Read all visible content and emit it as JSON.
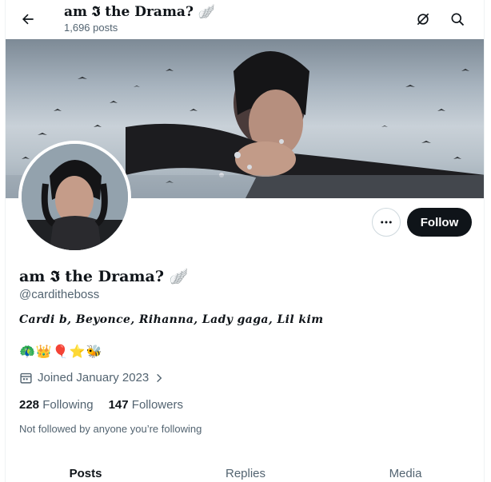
{
  "header": {
    "title": "am 𝕴 the Drama? 🪽",
    "post_count": "1,696 posts"
  },
  "profile": {
    "display_name": "am 𝕴 the Drama? 🪽",
    "handle": "@carditheboss",
    "bio": "Cardi b, Beyonce, Rihanna, Lady gaga, Lil kim",
    "emojis": "🦚👑🎈⭐🐝",
    "joined": "Joined January 2023",
    "following_count": "228",
    "following_label": "Following",
    "followers_count": "147",
    "followers_label": "Followers",
    "not_followed": "Not followed by anyone you’re following"
  },
  "actions": {
    "follow_label": "Follow"
  },
  "tabs": [
    {
      "label": "Posts",
      "active": true
    },
    {
      "label": "Replies",
      "active": false
    },
    {
      "label": "Media",
      "active": false
    }
  ],
  "colors": {
    "follow_bg": "#0f1419",
    "accent": "#1d9bf0",
    "muted": "#536471"
  }
}
